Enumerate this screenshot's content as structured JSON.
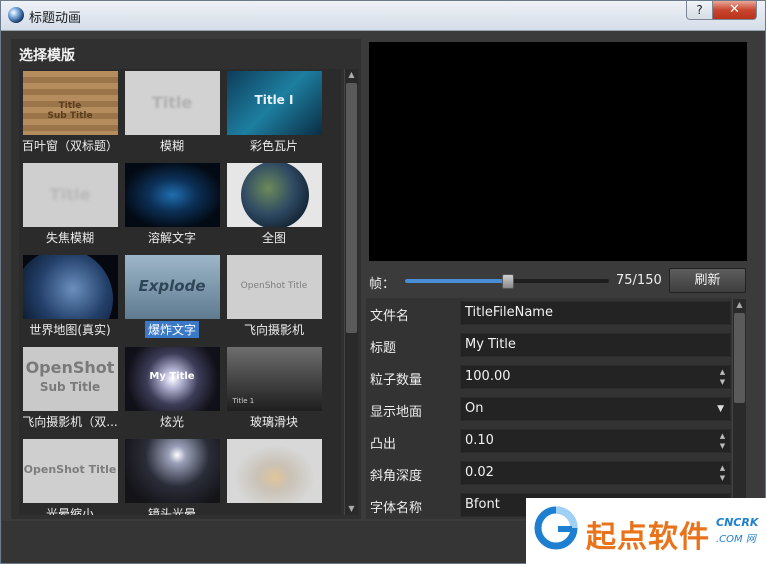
{
  "window": {
    "title": "标题动画",
    "help_label": "?",
    "close_label": "✕"
  },
  "template_panel": {
    "title": "选择模版",
    "items": [
      {
        "label": "百叶窗（双标题）",
        "thumb_text": "Title\nSub Title",
        "selected": false
      },
      {
        "label": "模糊",
        "thumb_text": "Title",
        "selected": false
      },
      {
        "label": "彩色瓦片",
        "thumb_text": "Title I",
        "selected": false
      },
      {
        "label": "失焦模糊",
        "thumb_text": "Title",
        "selected": false
      },
      {
        "label": "溶解文字",
        "thumb_text": "",
        "selected": false
      },
      {
        "label": "全图",
        "thumb_text": "",
        "selected": false
      },
      {
        "label": "世界地图(真实)",
        "thumb_text": "",
        "selected": false
      },
      {
        "label": "爆炸文字",
        "thumb_text": "Explode",
        "selected": true
      },
      {
        "label": "飞向摄影机",
        "thumb_text": "OpenShot Title",
        "selected": false
      },
      {
        "label": "飞向摄影机（双...",
        "thumb_text": "OpenShot\nSub Title",
        "selected": false
      },
      {
        "label": "炫光",
        "thumb_text": "My Title",
        "selected": false
      },
      {
        "label": "玻璃滑块",
        "thumb_text": "Title 1",
        "selected": false
      },
      {
        "label": "光晕缩小",
        "thumb_text": "OpenShot Title",
        "selected": false
      },
      {
        "label": "镜头光晕",
        "thumb_text": "",
        "selected": false
      },
      {
        "label": "",
        "thumb_text": "",
        "selected": false
      }
    ]
  },
  "frame": {
    "label": "帧：",
    "current": 75,
    "total": 150,
    "display": "75/150",
    "refresh_label": "刷新"
  },
  "properties": [
    {
      "label": "文件名",
      "value": "TitleFileName",
      "kind": "text"
    },
    {
      "label": "标题",
      "value": "My Title",
      "kind": "text"
    },
    {
      "label": "粒子数量",
      "value": "100.00",
      "kind": "spin"
    },
    {
      "label": "显示地面",
      "value": "On",
      "kind": "dropdown"
    },
    {
      "label": "凸出",
      "value": "0.10",
      "kind": "spin"
    },
    {
      "label": "斜角深度",
      "value": "0.02",
      "kind": "spin"
    },
    {
      "label": "字体名称",
      "value": "Bfont",
      "kind": "text"
    }
  ],
  "watermark": {
    "brand": "起点软件",
    "sub1": "CNCRK",
    "sub2": ".COM 网"
  }
}
